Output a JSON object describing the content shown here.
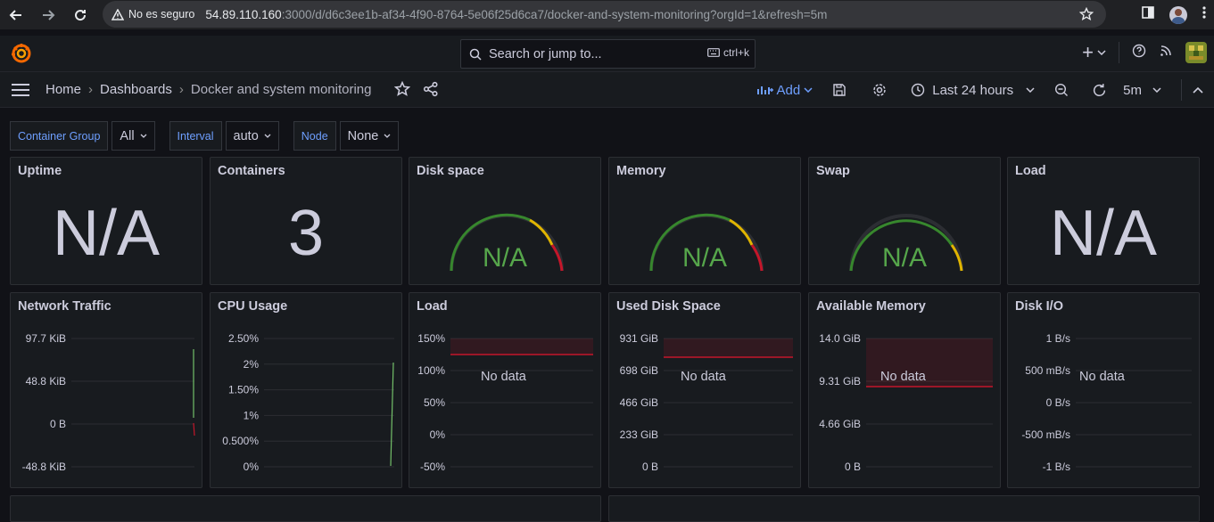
{
  "browser": {
    "security_label": "No es seguro",
    "url_host": "54.89.110.160",
    "url_rest": ":3000/d/d6c3ee1b-af34-4f90-8764-5e06f25d6ca7/docker-and-system-monitoring?orgId=1&refresh=5m"
  },
  "topbar": {
    "search_placeholder": "Search or jump to...",
    "search_shortcut": "ctrl+k",
    "plus_label": "+"
  },
  "navbar": {
    "breadcrumbs": [
      "Home",
      "Dashboards",
      "Docker and system monitoring"
    ],
    "separator": "›",
    "add_label": "Add",
    "time_range": "Last 24 hours",
    "refresh_interval": "5m"
  },
  "variables": [
    {
      "label": "Container Group",
      "value": "All"
    },
    {
      "label": "Interval",
      "value": "auto"
    },
    {
      "label": "Node",
      "value": "None"
    }
  ],
  "row1": [
    {
      "title": "Uptime",
      "kind": "stat",
      "value": "N/A"
    },
    {
      "title": "Containers",
      "kind": "stat",
      "value": "3"
    },
    {
      "title": "Disk space",
      "kind": "gauge",
      "value": "N/A"
    },
    {
      "title": "Memory",
      "kind": "gauge",
      "value": "N/A"
    },
    {
      "title": "Swap",
      "kind": "gauge",
      "value": "N/A"
    },
    {
      "title": "Load",
      "kind": "stat",
      "value": "N/A"
    }
  ],
  "row2": [
    {
      "title": "Network Traffic",
      "y_ticks": [
        "97.7 KiB",
        "48.8 KiB",
        "0 B",
        "-48.8 KiB"
      ],
      "no_data": ""
    },
    {
      "title": "CPU Usage",
      "y_ticks": [
        "2.50%",
        "2%",
        "1.50%",
        "1%",
        "0.500%",
        "0%"
      ],
      "no_data": ""
    },
    {
      "title": "Load",
      "y_ticks": [
        "150%",
        "100%",
        "50%",
        "0%",
        "-50%"
      ],
      "no_data": "No data"
    },
    {
      "title": "Used Disk Space",
      "y_ticks": [
        "931 GiB",
        "698 GiB",
        "466 GiB",
        "233 GiB",
        "0 B"
      ],
      "no_data": "No data"
    },
    {
      "title": "Available Memory",
      "y_ticks": [
        "14.0 GiB",
        "9.31 GiB",
        "4.66 GiB",
        "0 B"
      ],
      "no_data": "No data"
    },
    {
      "title": "Disk I/O",
      "y_ticks": [
        "1 B/s",
        "500 mB/s",
        "0 B/s",
        "-500 mB/s",
        "-1 B/s"
      ],
      "no_data": "No data"
    }
  ],
  "colors": {
    "accent": "#6e9fff",
    "threshold_red": "#c4162a",
    "gauge_green": "#37872d",
    "line_green": "#73bf69"
  }
}
